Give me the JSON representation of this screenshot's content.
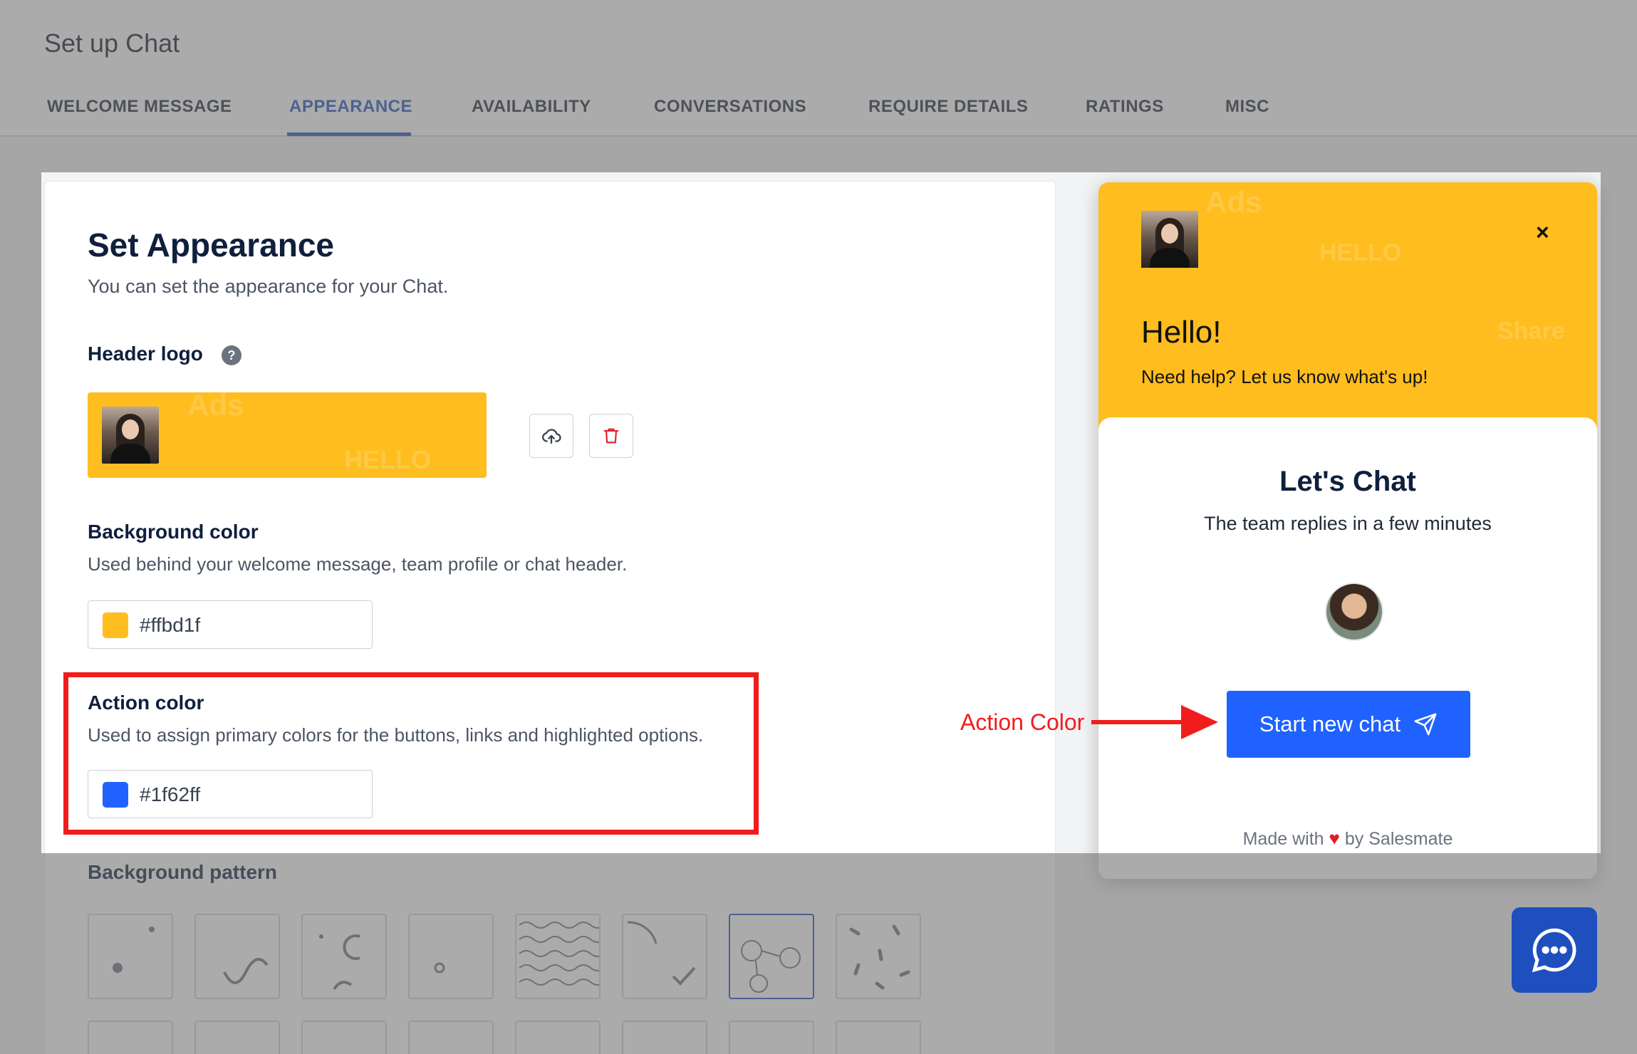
{
  "page": {
    "title": "Set up Chat"
  },
  "tabs": [
    {
      "label": "WELCOME MESSAGE"
    },
    {
      "label": "APPEARANCE"
    },
    {
      "label": "AVAILABILITY"
    },
    {
      "label": "CONVERSATIONS"
    },
    {
      "label": "REQUIRE DETAILS"
    },
    {
      "label": "RATINGS"
    },
    {
      "label": "MISC"
    }
  ],
  "active_tab": "APPEARANCE",
  "appearance": {
    "title": "Set Appearance",
    "subtitle": "You can set the appearance for your Chat.",
    "header_logo": {
      "label": "Header logo",
      "help_icon": "question-icon",
      "upload_icon": "cloud-upload-icon",
      "delete_icon": "trash-icon"
    },
    "background_color": {
      "label": "Background color",
      "description": "Used behind your welcome message, team profile or chat header.",
      "value": "#ffbd1f"
    },
    "action_color": {
      "label": "Action color",
      "description": "Used to assign primary colors for the buttons, links and highlighted options.",
      "value": "#1f62ff"
    },
    "background_pattern": {
      "label": "Background pattern",
      "selected_index": 6
    }
  },
  "chat_preview": {
    "greeting": "Hello!",
    "help_text": "Need help? Let us know what's up!",
    "close_label": "×",
    "card_title": "Let's Chat",
    "card_subtitle": "The team replies in a few minutes",
    "start_button": "Start new chat",
    "send_icon": "paper-plane-icon",
    "made_with_prefix": "Made with",
    "made_with_heart": "♥",
    "made_with_suffix": "by Salesmate",
    "launcher_icon": "chat-bubble-icon"
  },
  "annotation": {
    "label": "Action Color"
  },
  "colors": {
    "brand_yellow": "#ffbd1f",
    "action_blue": "#1f62ff",
    "tab_active": "#1f4fbf",
    "annotation_red": "#f11d1d"
  }
}
